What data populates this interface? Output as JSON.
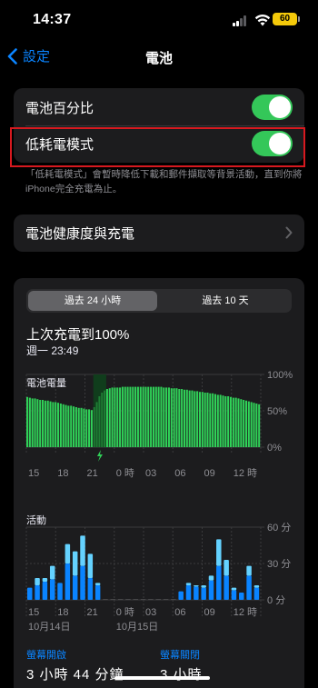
{
  "status": {
    "time": "14:37",
    "battery": "60"
  },
  "nav": {
    "back_label": "設定",
    "title": "電池"
  },
  "settings": {
    "battery_percentage": "電池百分比",
    "low_power_mode": "低耗電模式",
    "footnote": "「低耗電模式」會暫時降低下載和郵件擷取等背景活動，直到你將iPhone完全充電為止。",
    "battery_health": "電池健康度與充電"
  },
  "usage": {
    "tabs": [
      "過去 24 小時",
      "過去 10 天"
    ],
    "last_charged": "上次充電到100%",
    "last_charged_time": "週一 23:49",
    "battery_chart_title": "電池電量",
    "battery_y_ticks": [
      "100%",
      "50%",
      "0%"
    ],
    "activity_chart_title": "活動",
    "activity_y_ticks": [
      "60 分",
      "30 分",
      "0 分"
    ],
    "x_ticks": [
      "15",
      "18",
      "21",
      "0 時",
      "03",
      "06",
      "09",
      "12 時"
    ],
    "date_labels": [
      "10月14日",
      "10月15日"
    ],
    "screen_on_label": "螢幕開啟",
    "screen_on_value": "3 小時 44 分鐘",
    "screen_off_label": "螢幕關閉",
    "screen_off_value": "3 小時"
  },
  "chart_data": [
    {
      "type": "bar",
      "title": "電池電量",
      "ylim": [
        0,
        100
      ],
      "y_unit": "%",
      "x_ticks": [
        "15",
        "18",
        "21",
        "0 時",
        "03",
        "06",
        "09",
        "12 時"
      ],
      "color": "#30d158",
      "charging_color": "#1e7d34",
      "values": [
        69,
        68,
        67,
        67,
        66,
        65,
        65,
        64,
        64,
        63,
        62,
        62,
        61,
        60,
        59,
        58,
        57,
        57,
        56,
        55,
        54,
        54,
        53,
        52,
        52,
        51,
        55,
        62,
        70,
        75,
        78,
        80,
        81,
        82,
        82,
        82,
        82,
        83,
        83,
        83,
        83,
        83,
        83,
        83,
        83,
        83,
        83,
        83,
        83,
        83,
        83,
        83,
        83,
        82,
        82,
        82,
        81,
        81,
        81,
        80,
        80,
        79,
        79,
        78,
        78,
        77,
        77,
        76,
        76,
        75,
        75,
        74,
        74,
        73,
        72,
        72,
        71,
        70,
        70,
        69,
        68,
        68,
        67,
        66,
        65,
        64,
        63,
        62,
        61,
        60,
        59
      ],
      "charging_start": 26,
      "charging_end": 31
    },
    {
      "type": "bar",
      "title": "活動",
      "ylim": [
        0,
        60
      ],
      "y_unit": "分",
      "x_ticks": [
        "15",
        "18",
        "21",
        "0 時",
        "03",
        "06",
        "09",
        "12 時"
      ],
      "date_labels": [
        "10月14日",
        "10月15日"
      ],
      "series": [
        {
          "name": "",
          "color": "#0a84ff",
          "values": [
            10,
            12,
            15,
            17,
            14,
            30,
            20,
            28,
            18,
            12,
            0,
            0,
            0,
            0,
            0,
            0,
            0,
            0,
            0,
            0,
            7,
            12,
            11,
            10,
            16,
            28,
            20,
            8,
            6,
            20,
            10
          ]
        },
        {
          "name": "",
          "color": "#64d2ff",
          "values": [
            0,
            6,
            3,
            11,
            0,
            16,
            20,
            25,
            20,
            2,
            0,
            0,
            0,
            0,
            0,
            0,
            0,
            0,
            0,
            0,
            0,
            2,
            1,
            2,
            4,
            22,
            13,
            2,
            0,
            8,
            2
          ]
        }
      ]
    }
  ]
}
